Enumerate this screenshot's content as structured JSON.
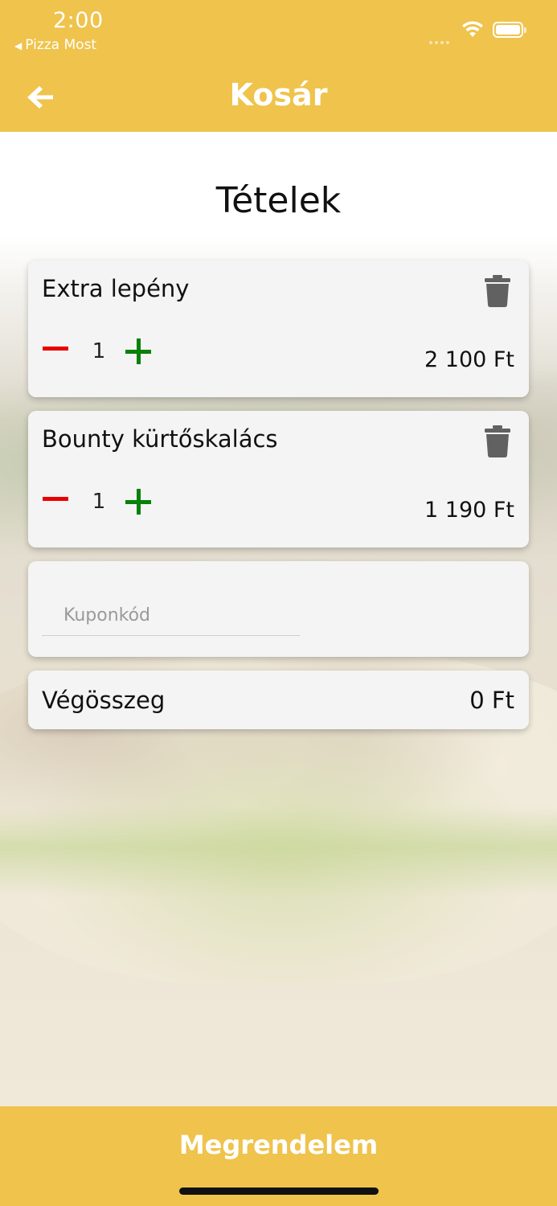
{
  "status_bar": {
    "time": "2:00",
    "back_app": "Pizza Most"
  },
  "header": {
    "title": "Kosár",
    "back_icon": "arrow-left-icon",
    "color": "#efc34c"
  },
  "section_title": "Tételek",
  "cart": {
    "items": [
      {
        "name": "Extra lepény",
        "quantity": "1",
        "price": "2 100 Ft"
      },
      {
        "name": "Bounty kürtőskalács",
        "quantity": "1",
        "price": "1 190 Ft"
      }
    ]
  },
  "coupon": {
    "placeholder": "Kuponkód",
    "value": ""
  },
  "total": {
    "label": "Végösszeg",
    "value": "0 Ft"
  },
  "footer": {
    "order_label": "Megrendelem"
  },
  "colors": {
    "accent": "#efc34c",
    "minus": "#e80000",
    "plus": "#078107",
    "card": "#f4f4f4"
  }
}
